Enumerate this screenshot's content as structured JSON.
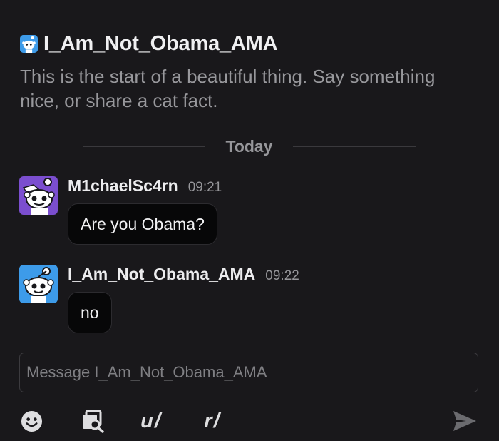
{
  "header": {
    "title": "I_Am_Not_Obama_AMA",
    "intro": "This is the start of a beautiful thing. Say something nice, or share a cat fact."
  },
  "divider": {
    "label": "Today"
  },
  "messages": [
    {
      "author": "M1chaelSc4rn",
      "time": "09:21",
      "text": "Are you Obama?",
      "avatar_color": "#7b4ecf"
    },
    {
      "author": "I_Am_Not_Obama_AMA",
      "time": "09:22",
      "text": "no",
      "avatar_color": "#3d9be9"
    }
  ],
  "composer": {
    "placeholder": "Message I_Am_Not_Obama_AMA"
  },
  "toolbar": {
    "emoji_icon": "emoji-icon",
    "gallery_icon": "image-search-icon",
    "user_label": "u/",
    "subreddit_label": "r/",
    "send_icon": "send-icon"
  },
  "colors": {
    "background": "#19181b",
    "bubble": "#070708",
    "muted_text": "#96969a",
    "avatar_blue": "#3d9be9",
    "avatar_purple": "#7b4ecf"
  }
}
